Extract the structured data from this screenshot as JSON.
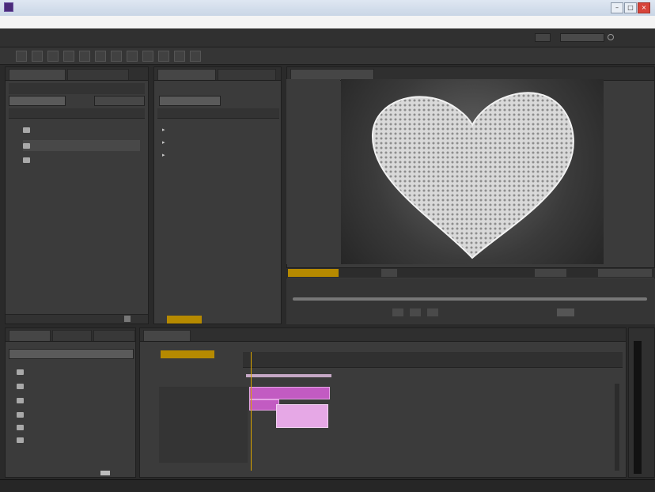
{
  "window": {
    "title": "",
    "controls": {
      "minimize": "–",
      "maximize": "□",
      "close": "×"
    }
  },
  "menubar": {
    "items": [
      "",
      "",
      "",
      "",
      "",
      "",
      "",
      ""
    ]
  },
  "toolbar": {
    "tools": [
      "",
      "",
      "",
      "",
      "",
      "",
      "",
      "",
      "",
      "",
      "",
      ""
    ]
  },
  "project_panel": {
    "tabs": [
      "",
      ""
    ],
    "items": [
      "",
      "",
      ""
    ]
  },
  "middle_panel": {
    "tabs": [
      "",
      ""
    ],
    "items": [
      "",
      "",
      ""
    ]
  },
  "viewer": {
    "tab": "",
    "timecode": ""
  },
  "effects_panel": {
    "tabs": [
      "",
      "",
      ""
    ],
    "folders": [
      "",
      "",
      "",
      "",
      "",
      ""
    ]
  },
  "timeline": {
    "tab": "",
    "timecode": "",
    "ruler_labels": [
      "",
      "",
      "",
      "",
      ""
    ],
    "track_labels": [
      "",
      "",
      ""
    ]
  },
  "colors": {
    "clip_pink": "#c25bc2",
    "clip_light": "#e6a8e6",
    "accent_yellow": "#b68a00"
  }
}
